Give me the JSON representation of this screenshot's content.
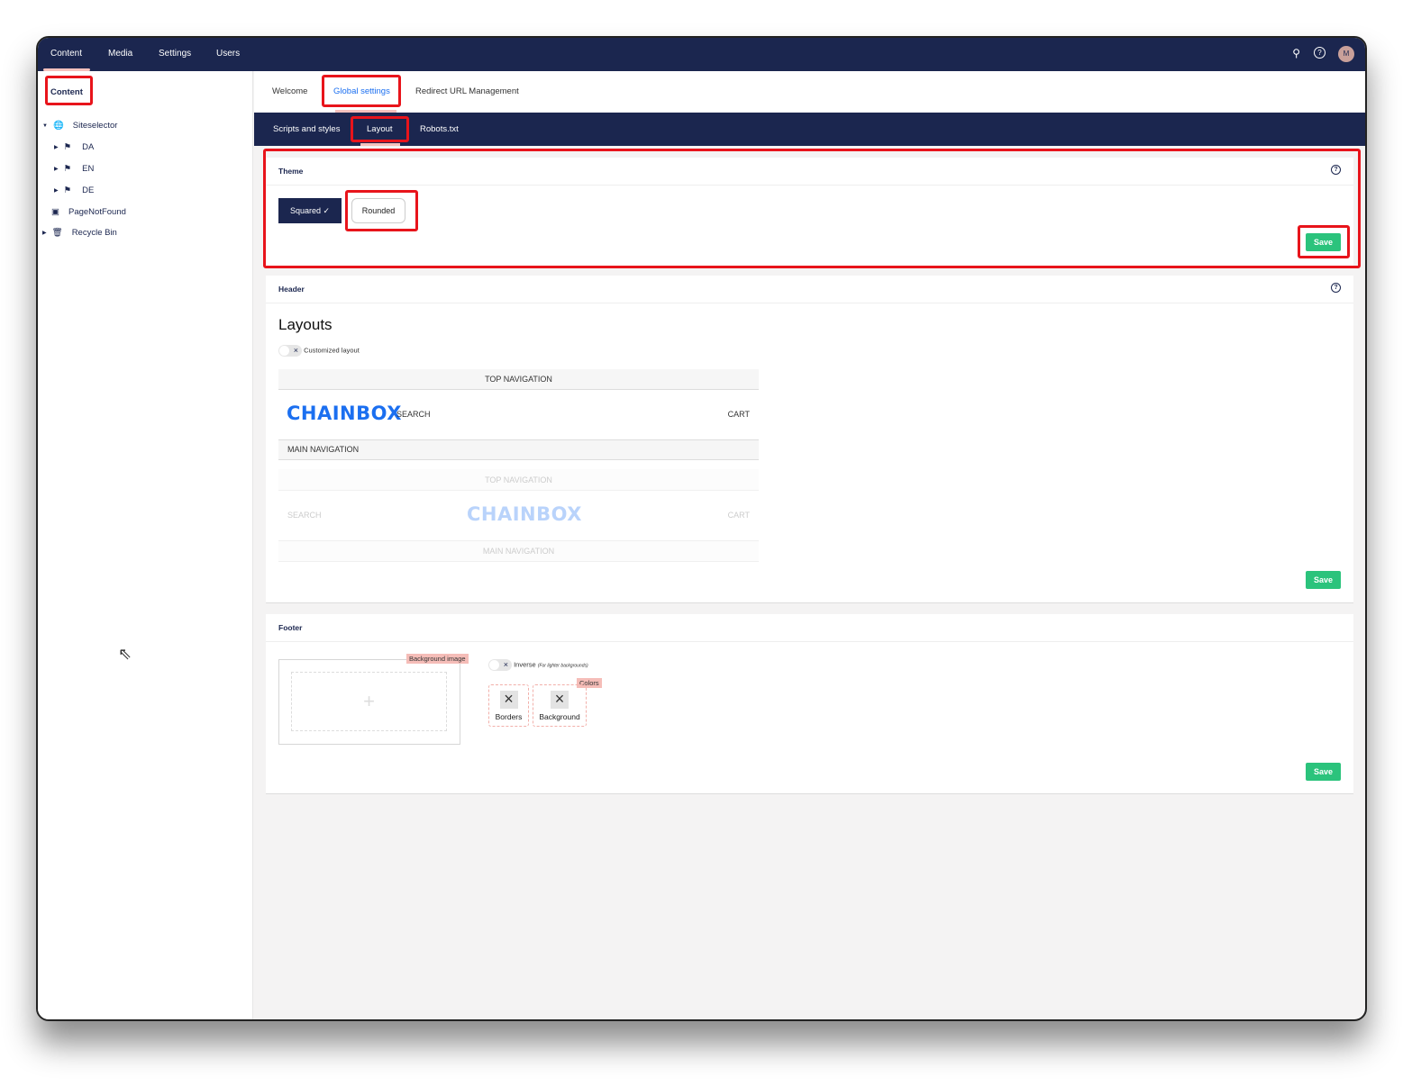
{
  "topnav": {
    "sections": [
      "Content",
      "Media",
      "Settings",
      "Users"
    ],
    "avatar": "M"
  },
  "sidebar": {
    "title": "Content",
    "tree": [
      {
        "label": "Siteselector"
      },
      {
        "label": "DA"
      },
      {
        "label": "EN"
      },
      {
        "label": "DE"
      },
      {
        "label": "PageNotFound"
      },
      {
        "label": "Recycle Bin"
      }
    ]
  },
  "tabs": [
    "Welcome",
    "Global settings",
    "Redirect URL Management"
  ],
  "subtabs": [
    "Scripts and styles",
    "Layout",
    "Robots.txt"
  ],
  "theme": {
    "title": "Theme",
    "options": [
      "Squared",
      "Rounded"
    ],
    "selected_mark": "✓",
    "save": "Save"
  },
  "header": {
    "title": "Header",
    "heading": "Layouts",
    "toggle_label": "Customized layout",
    "layout1": {
      "top": "TOP NAVIGATION",
      "logo": "CHAINBOX",
      "search": "SEARCH",
      "cart": "CART",
      "main": "MAIN NAVIGATION"
    },
    "layout2": {
      "top": "TOP NAVIGATION",
      "logo": "CHAINBOX",
      "search": "SEARCH",
      "cart": "CART",
      "main": "MAIN NAVIGATION"
    },
    "save": "Save"
  },
  "footer": {
    "title": "Footer",
    "bg_image_tag": "Background image",
    "plus": "+",
    "inverse_label": "Inverse",
    "inverse_note": "(For lighter backgrounds)",
    "colors_tag": "Colors",
    "color_boxes": [
      "Borders",
      "Background"
    ],
    "save": "Save"
  },
  "colors": {
    "navy": "#1b264f",
    "green": "#2bc37c",
    "accent": "#1b6ff0"
  }
}
